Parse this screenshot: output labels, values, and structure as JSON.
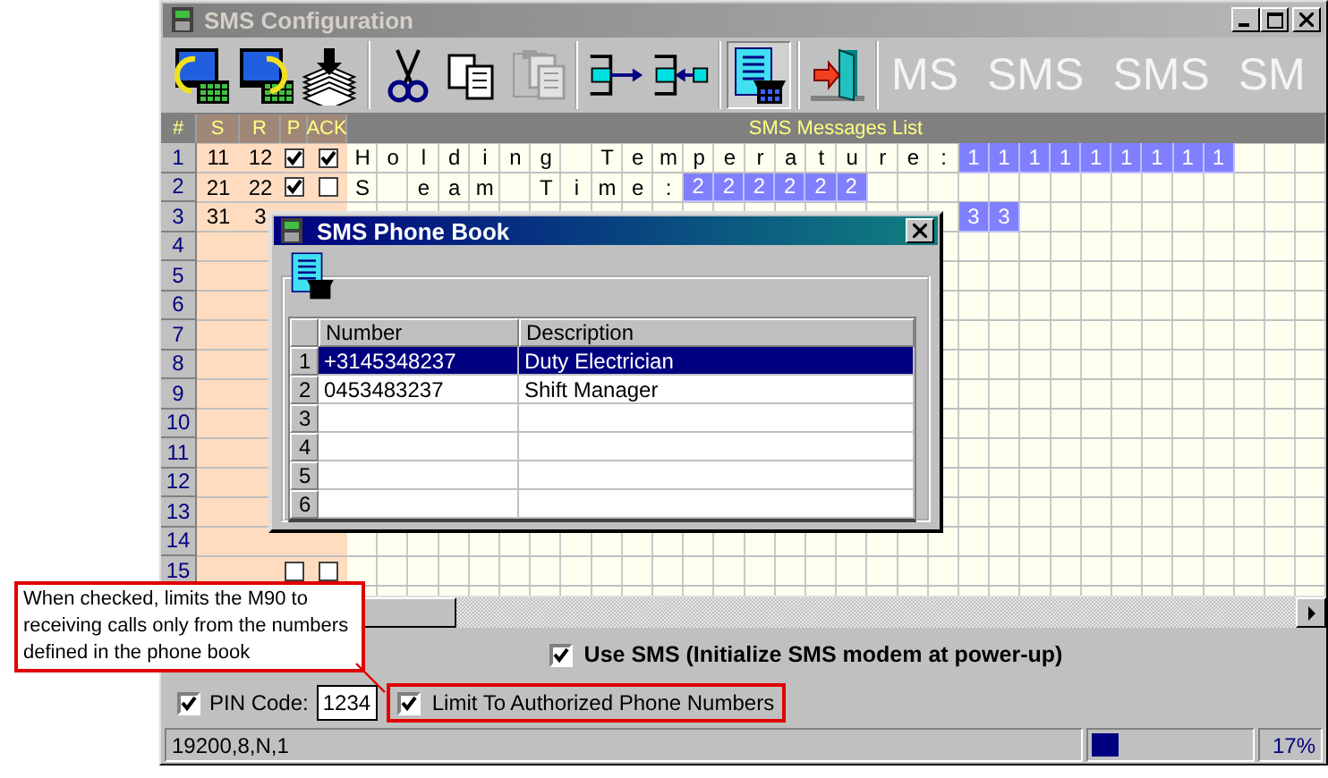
{
  "window": {
    "title": "SMS Configuration",
    "active": false
  },
  "toolbar": {
    "groups": [
      {
        "items": [
          {
            "kind": "pc_read",
            "pressed": false,
            "disabled": false
          },
          {
            "kind": "pc_write",
            "pressed": false,
            "disabled": false
          },
          {
            "kind": "save_stack",
            "pressed": false,
            "disabled": false
          }
        ]
      },
      {
        "items": [
          {
            "kind": "cut",
            "pressed": false,
            "disabled": false
          },
          {
            "kind": "copy",
            "pressed": false,
            "disabled": false
          },
          {
            "kind": "paste",
            "pressed": false,
            "disabled": true
          }
        ]
      },
      {
        "items": [
          {
            "kind": "export",
            "pressed": false,
            "disabled": false
          },
          {
            "kind": "import",
            "pressed": false,
            "disabled": false
          }
        ]
      },
      {
        "items": [
          {
            "kind": "phone_book",
            "pressed": true,
            "disabled": false
          }
        ]
      },
      {
        "items": [
          {
            "kind": "exit",
            "pressed": false,
            "disabled": false
          }
        ]
      }
    ],
    "watermark": [
      "MS",
      "SMS",
      "SMS",
      "SM"
    ]
  },
  "grid": {
    "columns": [
      "#",
      "S",
      "R",
      "P",
      "ACK",
      "SMS Messages List"
    ],
    "rows": [
      {
        "number": "1",
        "s": "11",
        "r": "12",
        "p": true,
        "ack": true,
        "cells": [
          "H",
          "o",
          "l",
          "d",
          "i",
          "n",
          "g",
          " ",
          "T",
          "e",
          "m",
          "p",
          "e",
          "r",
          "a",
          "t",
          "u",
          "r",
          "e",
          ":"
        ],
        "field": [
          "1",
          "1",
          "1",
          "1",
          "1",
          "1",
          "1",
          "1",
          "1"
        ]
      },
      {
        "number": "2",
        "s": "21",
        "r": "22",
        "p": true,
        "ack": false,
        "cells": [
          "S",
          " ",
          "e",
          "a",
          "m",
          " ",
          "T",
          "i",
          "m",
          "e",
          ":"
        ],
        "field": [
          "2",
          "2",
          "2",
          "2",
          "2",
          "2"
        ]
      },
      {
        "number": "3",
        "s": "31",
        "r": "3",
        "cells": [
          " ",
          " ",
          " ",
          " ",
          " ",
          " ",
          " ",
          " ",
          " ",
          " ",
          " ",
          " ",
          " ",
          " ",
          " ",
          " ",
          " ",
          " ",
          " ",
          " "
        ],
        "field": [
          "3",
          "3"
        ]
      },
      {
        "number": "4"
      },
      {
        "number": "5"
      },
      {
        "number": "6"
      },
      {
        "number": "7"
      },
      {
        "number": "8"
      },
      {
        "number": "9"
      },
      {
        "number": "10"
      },
      {
        "number": "11"
      },
      {
        "number": "12"
      },
      {
        "number": "13"
      },
      {
        "number": "14"
      },
      {
        "number": "15",
        "p": false,
        "ack": false
      }
    ]
  },
  "use_sms": {
    "label": "Use SMS (Initialize SMS modem at power-up)",
    "checked": true
  },
  "pin_code": {
    "label": "PIN Code:",
    "checked": true,
    "value": "1234"
  },
  "limit_authorized": {
    "label": "Limit To Authorized Phone Numbers",
    "checked": true,
    "highlighted": true
  },
  "status_bar": {
    "port": "19200,8,N,1",
    "progress": {
      "level": 0.17
    },
    "percent": "17%"
  },
  "callout": {
    "text": "When checked, limits the M90 to receiving calls only from the numbers defined in the phone book"
  },
  "phone_book": {
    "title": "SMS Phone Book",
    "active": true,
    "columns": [
      "Number",
      "Description"
    ],
    "rows": [
      {
        "index": "1",
        "number": "+3145348237",
        "description": "Duty Electrician",
        "selected": true
      },
      {
        "index": "2",
        "number": "0453483237",
        "description": "Shift Manager",
        "selected": false
      },
      {
        "index": "3",
        "selected": false
      },
      {
        "index": "4",
        "selected": false
      },
      {
        "index": "5",
        "selected": false
      },
      {
        "index": "6",
        "selected": false
      }
    ]
  }
}
